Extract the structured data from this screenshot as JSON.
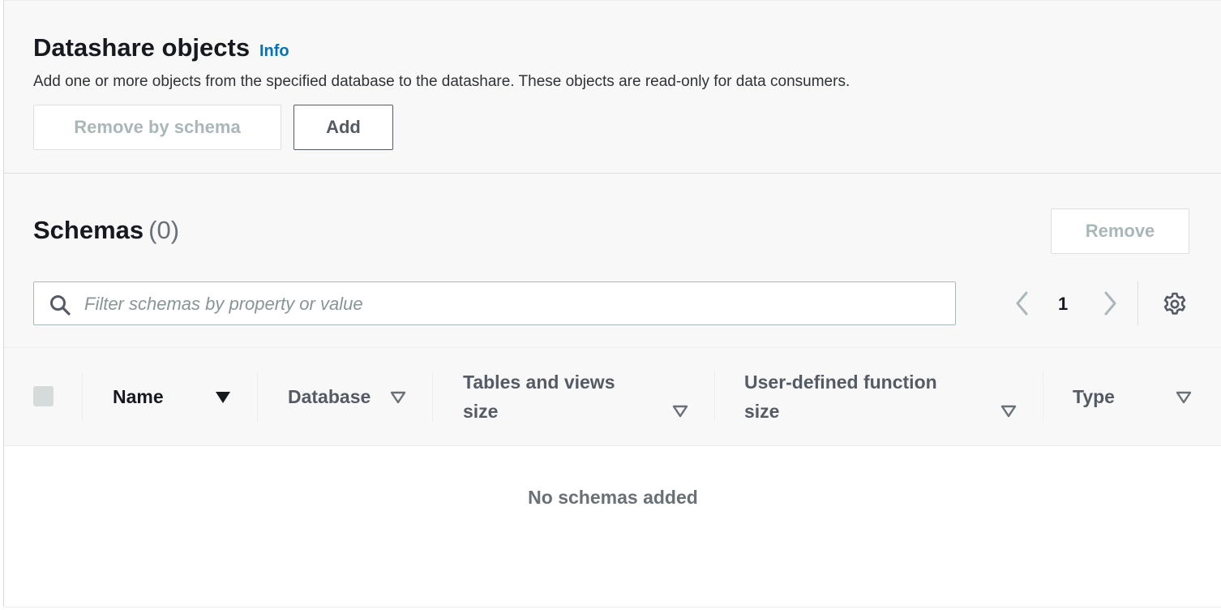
{
  "header": {
    "title": "Datashare objects",
    "info_label": "Info",
    "description": "Add one or more objects from the specified database to the datashare. These objects are read-only for data consumers.",
    "remove_by_schema_label": "Remove by schema",
    "add_label": "Add"
  },
  "schemas": {
    "title": "Schemas",
    "count": "(0)",
    "remove_label": "Remove",
    "filter_placeholder": "Filter schemas by property or value",
    "filter_value": "",
    "current_page": "1",
    "columns": [
      {
        "line1": "Name",
        "line2": "",
        "sort": "descending"
      },
      {
        "line1": "Database",
        "line2": "",
        "sort": "none"
      },
      {
        "line1": "Tables and views",
        "line2": "size",
        "sort": "none"
      },
      {
        "line1": "User-defined function",
        "line2": "size",
        "sort": "none"
      },
      {
        "line1": "Type",
        "line2": "",
        "sort": "none"
      }
    ],
    "empty_message": "No schemas added"
  },
  "colors": {
    "accent_link": "#0073bb",
    "disabled_text": "#aab7b8",
    "panel_background": "#f8f8f8"
  },
  "icons": {
    "search": "search-icon",
    "prev": "chevron-left-icon",
    "next": "chevron-right-icon",
    "settings": "gear-icon",
    "sort_active": "caret-down-filled-icon",
    "sort_inactive": "caret-down-outline-icon"
  }
}
